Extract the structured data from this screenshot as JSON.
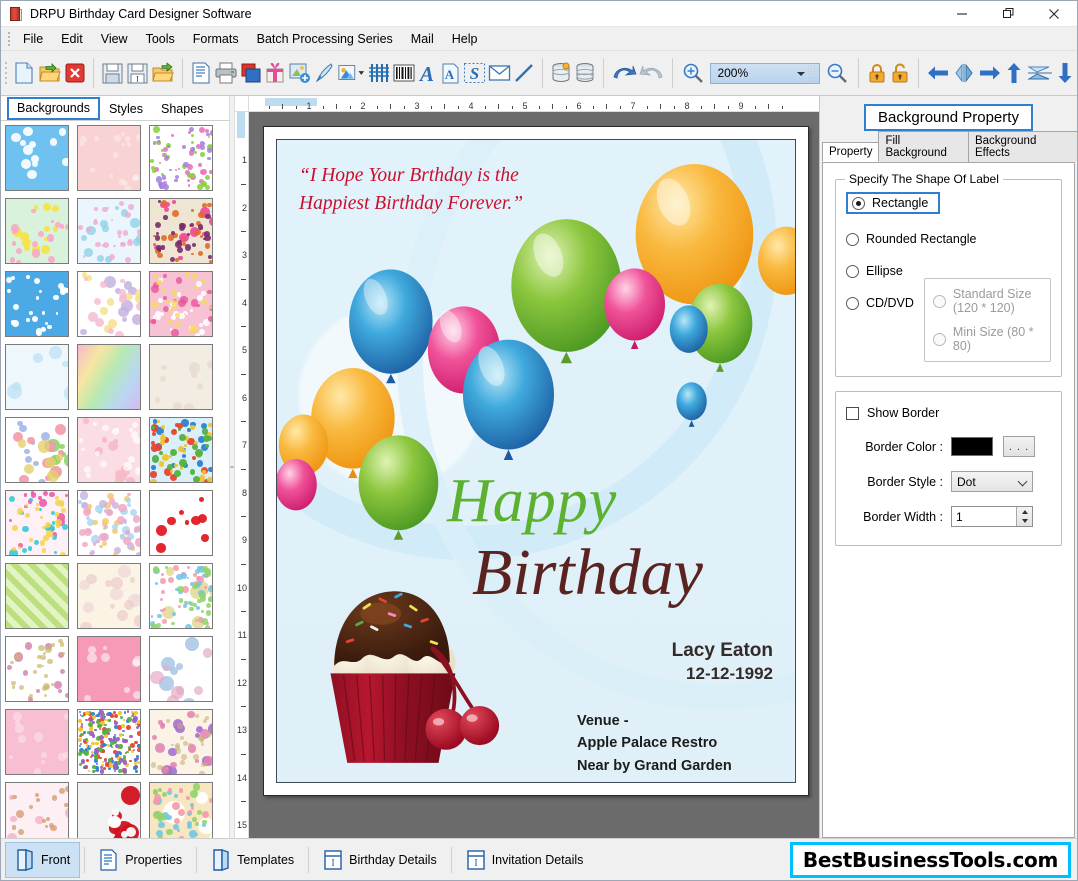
{
  "window": {
    "title": "DRPU Birthday Card Designer Software",
    "app_icon": "book-icon",
    "minimize": "—",
    "maximize": "❐",
    "close": "✕"
  },
  "menu": {
    "items": [
      "File",
      "Edit",
      "View",
      "Tools",
      "Formats",
      "Batch Processing Series",
      "Mail",
      "Help"
    ]
  },
  "toolbar": {
    "groups": [
      {
        "buttons": [
          {
            "name": "new-document-icon",
            "tip": "New"
          },
          {
            "name": "open-folder-icon",
            "tip": "Open"
          },
          {
            "name": "close-red-x-icon",
            "tip": "Close"
          }
        ]
      },
      {
        "buttons": [
          {
            "name": "save-icon",
            "tip": "Save"
          },
          {
            "name": "save-as-icon",
            "tip": "Save As"
          },
          {
            "name": "export-folder-icon",
            "tip": "Export"
          }
        ]
      },
      {
        "buttons": [
          {
            "name": "page-setup-icon",
            "tip": "Page Setup"
          },
          {
            "name": "print-icon",
            "tip": "Print"
          },
          {
            "name": "card-stack-icon",
            "tip": "Cards"
          },
          {
            "name": "gift-box-icon",
            "tip": "Gift"
          },
          {
            "name": "add-image-icon",
            "tip": "Add Image"
          },
          {
            "name": "pen-icon",
            "tip": "Pen"
          },
          {
            "name": "shape-picture-dropdown-icon",
            "tip": "Shapes"
          },
          {
            "name": "watermark-icon",
            "tip": "Watermark"
          },
          {
            "name": "barcode-icon",
            "tip": "Barcode"
          },
          {
            "name": "text-a-icon",
            "tip": "Text"
          },
          {
            "name": "text-box-icon",
            "tip": "Text Box"
          },
          {
            "name": "signature-s-icon",
            "tip": "Signature"
          },
          {
            "name": "envelope-icon",
            "tip": "Mail"
          },
          {
            "name": "line-icon",
            "tip": "Line"
          }
        ]
      },
      {
        "buttons": [
          {
            "name": "database-add-icon",
            "tip": "Database"
          },
          {
            "name": "database-icon",
            "tip": "Database List"
          }
        ]
      },
      {
        "buttons": [
          {
            "name": "undo-icon",
            "tip": "Undo"
          },
          {
            "name": "redo-icon",
            "tip": "Redo"
          }
        ]
      },
      {
        "buttons": [
          {
            "name": "zoom-in-icon",
            "tip": "Zoom In"
          }
        ]
      },
      {
        "buttons": [
          {
            "name": "zoom-out-icon",
            "tip": "Zoom Out"
          }
        ]
      },
      {
        "buttons": [
          {
            "name": "lock-icon",
            "tip": "Lock"
          },
          {
            "name": "unlock-icon",
            "tip": "Unlock"
          }
        ]
      },
      {
        "buttons": [
          {
            "name": "align-left-icon",
            "tip": "Align Left"
          },
          {
            "name": "align-center-horizontal-icon",
            "tip": "Center Horizontally"
          },
          {
            "name": "align-right-icon",
            "tip": "Align Right"
          },
          {
            "name": "align-top-icon",
            "tip": "Align Top"
          },
          {
            "name": "align-center-vertical-icon",
            "tip": "Center Vertically"
          },
          {
            "name": "align-bottom-icon",
            "tip": "Align Bottom"
          }
        ]
      }
    ],
    "zoom_value": "200%"
  },
  "left_panel": {
    "tabs": [
      {
        "label": "Backgrounds",
        "selected": true
      },
      {
        "label": "Styles",
        "selected": false
      },
      {
        "label": "Shapes",
        "selected": false
      }
    ],
    "thumbnails": [
      {
        "name": "clouds-sky"
      },
      {
        "name": "pink-floral-texture"
      },
      {
        "name": "butterflies-flowers"
      },
      {
        "name": "yellow-daisies"
      },
      {
        "name": "winter-snow-scene"
      },
      {
        "name": "balloons-bird-beige"
      },
      {
        "name": "blue-stars"
      },
      {
        "name": "pastel-balloons-white"
      },
      {
        "name": "pink-cakes-balloons"
      },
      {
        "name": "blue-bubbles"
      },
      {
        "name": "rainbow-pastel-swirl"
      },
      {
        "name": "cream-faded-floral"
      },
      {
        "name": "happy-birthday-balloons"
      },
      {
        "name": "pink-hearts-stripes"
      },
      {
        "name": "colored-balloons-sky"
      },
      {
        "name": "pink-cyan-hearts"
      },
      {
        "name": "balloon-bouquets"
      },
      {
        "name": "red-hearts-white"
      },
      {
        "name": "green-diagonal-stripes"
      },
      {
        "name": "cream-tiered-cakes"
      },
      {
        "name": "party-gifts-confetti"
      },
      {
        "name": "pink-petals-white"
      },
      {
        "name": "pink-swirl-hearts"
      },
      {
        "name": "gift-boxes-white"
      },
      {
        "name": "pink-soft-texture"
      },
      {
        "name": "confetti-sprinkles-white"
      },
      {
        "name": "purple-orchid-cream"
      },
      {
        "name": "pink-cupcakes-pattern"
      },
      {
        "name": "red-white-hearts"
      },
      {
        "name": "birthday-cake-balloons"
      }
    ]
  },
  "rulers": {
    "horizontal_labels": [
      "1",
      "2",
      "3",
      "4",
      "5",
      "6",
      "7",
      "8",
      "9"
    ],
    "vertical_labels": [
      "1",
      "2",
      "3",
      "4",
      "5",
      "6",
      "7",
      "8",
      "9",
      "10",
      "11",
      "12",
      "13",
      "14",
      "15"
    ]
  },
  "card": {
    "quote_line1": "“I Hope Your Brthday is the",
    "quote_line2": "Happiest Birthday Forever.”",
    "happy": "Happy",
    "birthday": "Birthday",
    "person_name": "Lacy Eaton",
    "person_date": "12-12-1992",
    "venue_line1": "Venue -",
    "venue_line2": "Apple Palace Restro",
    "venue_line3": "Near by Grand Garden",
    "colors": {
      "quote": "#c8102e",
      "happy": "#5cb130",
      "birthday": "#5b2320",
      "background": "#e2f2fa"
    }
  },
  "right_panel": {
    "heading": "Background Property",
    "tabs": [
      {
        "label": "Property",
        "selected": true
      },
      {
        "label": "Fill Background",
        "selected": false
      },
      {
        "label": "Background Effects",
        "selected": false
      }
    ],
    "shape_group": {
      "legend": "Specify The Shape Of Label",
      "options": [
        {
          "label": "Rectangle",
          "selected": true,
          "highlighted": true,
          "disabled": false
        },
        {
          "label": "Rounded Rectangle",
          "selected": false,
          "highlighted": false,
          "disabled": false
        },
        {
          "label": "Ellipse",
          "selected": false,
          "highlighted": false,
          "disabled": false
        },
        {
          "label": "CD/DVD",
          "selected": false,
          "highlighted": false,
          "disabled": false
        }
      ],
      "cd_sizes": [
        {
          "label": "Standard Size (120 * 120)",
          "selected": false,
          "disabled": true
        },
        {
          "label": "Mini Size (80 * 80)",
          "selected": false,
          "disabled": true
        }
      ]
    },
    "border_group": {
      "show_border_label": "Show Border",
      "show_border_checked": false,
      "border_color_label": "Border Color :",
      "border_color_value": "#000000",
      "browse_button_label": ". . .",
      "border_style_label": "Border Style :",
      "border_style_value": "Dot",
      "border_width_label": "Border Width :",
      "border_width_value": "1"
    }
  },
  "status_bar": {
    "buttons": [
      {
        "label": "Front",
        "icon": "card-front-icon",
        "selected": true
      },
      {
        "label": "Properties",
        "icon": "properties-list-icon",
        "selected": false
      },
      {
        "label": "Templates",
        "icon": "templates-book-icon",
        "selected": false
      },
      {
        "label": "Birthday Details",
        "icon": "birthday-details-icon",
        "selected": false
      },
      {
        "label": "Invitation Details",
        "icon": "invitation-details-icon",
        "selected": false
      }
    ],
    "brand": "BestBusinessTools.com",
    "brand_border_color": "#00bfff"
  }
}
